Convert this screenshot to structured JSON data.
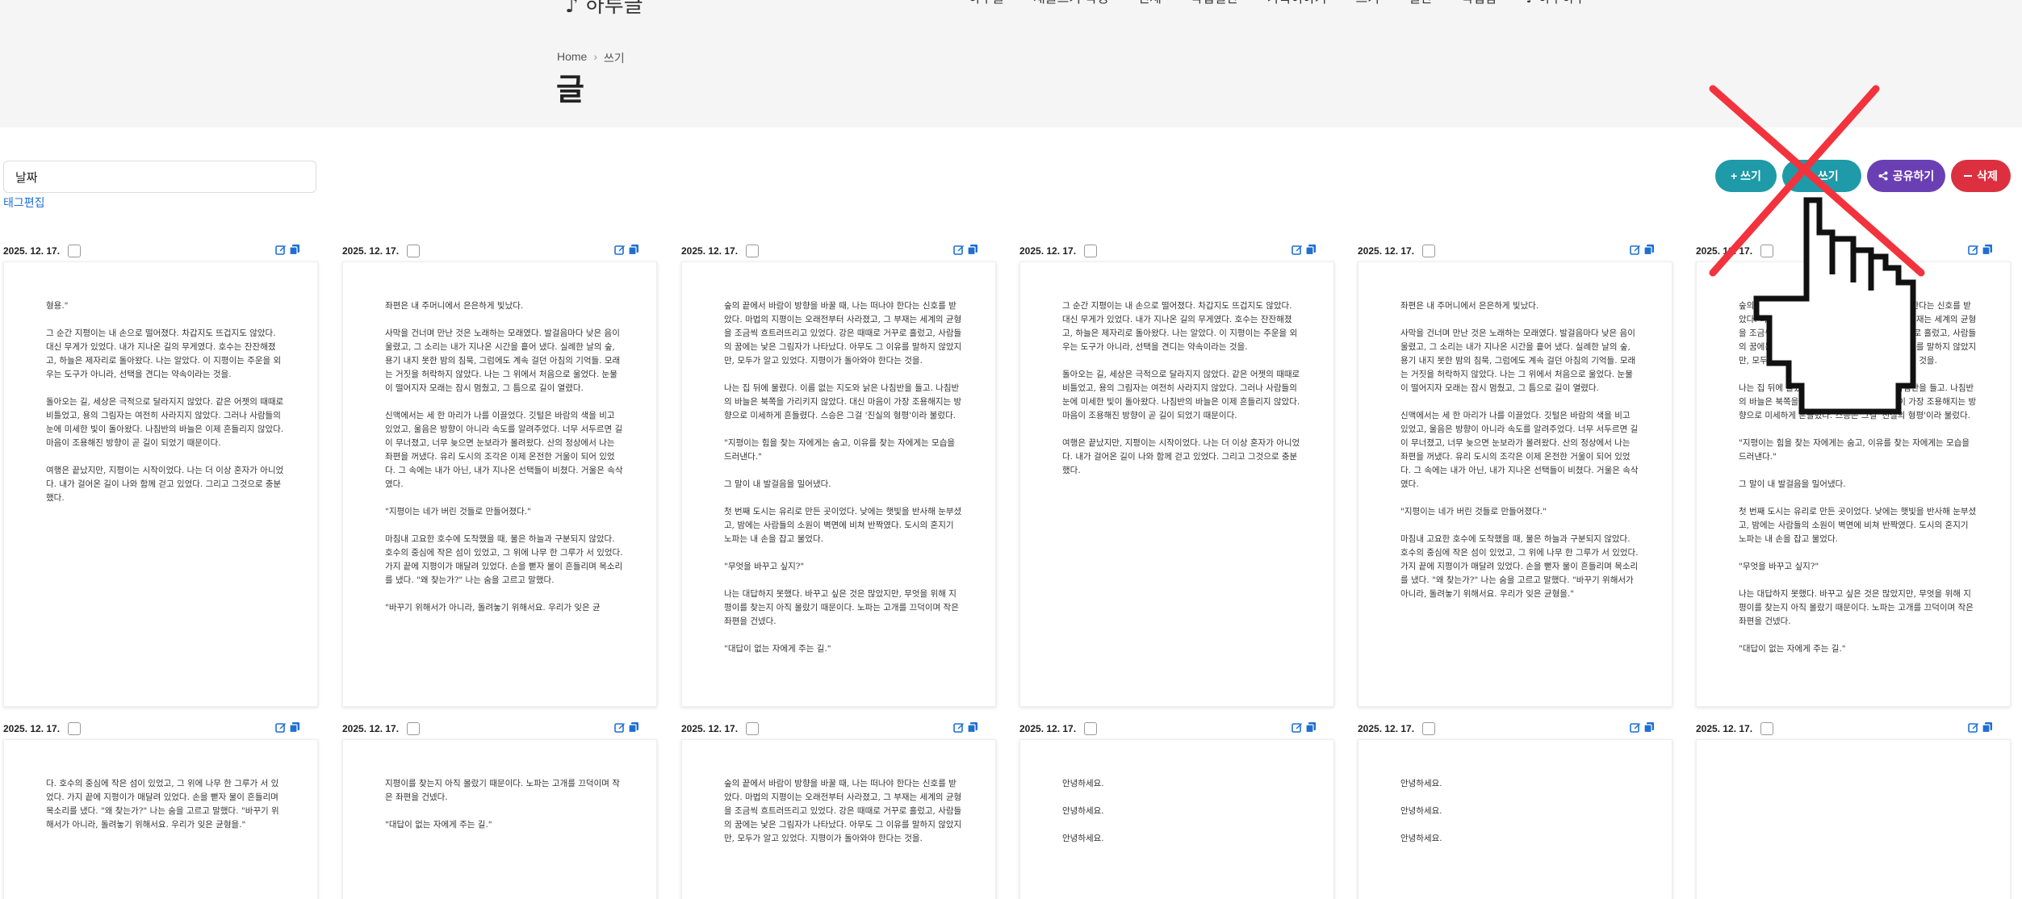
{
  "header": {
    "logo": "♪ 하루글",
    "nav": [
      "하루글",
      "새글쓰기 작성",
      "전체",
      "작업일반",
      "가족이야기",
      "쓰기",
      "일반",
      "작업함",
      "♪ 하루하루"
    ]
  },
  "breadcrumb": {
    "home": "Home",
    "sep": "›",
    "current": "쓰기"
  },
  "page_title": "글",
  "toolbar": {
    "sort_label": "날짜",
    "tag_edit": "태그편집",
    "write": "+ 쓰기",
    "write2": "✎ 쓰기",
    "share": "공유하기",
    "delete": "삭제"
  },
  "colors": {
    "write": "#1e9aa8",
    "share": "#6b3fb4",
    "delete": "#dc3040",
    "accent": "#1f6fd0"
  },
  "cards": [
    {
      "date": "2025. 12. 17.",
      "paragraphs": [
        "형용.\"",
        "그 순간 지평이는 내 손으로 떨어졌다. 차갑지도 뜨겁지도 않았다. 대신 무게가 있었다. 내가 지나온 길의 무게였다. 호수는 잔잔해졌고, 하늘은 제자리로 돌아왔다. 나는 알았다. 이 지평이는 주운을 외우는 도구가 아니라, 선택을 견디는 약속이라는 것을.",
        "돌아오는 길, 세상은 극적으로 달라지지 않았다. 같은 어젯의 때때로 비틀었고, 용의 그림자는 여전히 사라지지 않았다. 그러나 사람들의 눈에 미세한 빛이 돌아왔다. 나침반의 바늘은 이제 흔들리지 않았다. 마음이 조용해진 방향이 곧 길이 되었기 때문이다.",
        "여행은 끝났지만, 지평이는 시작이었다. 나는 더 이상 혼자가 아니었다. 내가 걸어온 길이 나와 함께 걷고 있었다. 그리고 그것으로 충분했다."
      ]
    },
    {
      "date": "2025. 12. 17.",
      "paragraphs": [
        "좌편은 내 주머니에서 은은하게 빛났다.",
        "사막을 건너며 만난 것은 노래하는 모래였다. 발걸음마다 낮은 음이 울렸고, 그 소리는 내가 지나온 시간을 흩어 냈다. 실례한 날의 숲, 용기 내지 못한 밤의 침묵, 그럼에도 계속 걸던 아침의 기억들. 모래는 거짓을 허락하지 않았다. 나는 그 위에서 처음으로 울었다. 눈물이 떨어지자 모래는 잠시 멈췄고, 그 틈으로 길이 열렸다.",
        "신맥에서는 세 한 마리가 나를 이끌었다. 깃털은 바람의 색을 비고 있었고, 울음은 방향이 아니라 속도를 알려주었다. 너무 서두르면 길이 무너졌고, 너무 늦으면 눈보라가 몰려왔다. 산의 정상에서 나는 좌편을 꺼냈다. 유리 도시의 조각은 이제 온전한 거울이 되어 있었다. 그 속에는 내가 아닌, 내가 지나온 선택들이 비쳤다. 거울은 속삭였다.",
        "\"지평이는 네가 버린 것들로 만들어졌다.\"",
        "마침내 고요한 호수에 도착했을 때, 물은 하늘과 구분되지 않았다. 호수의 중심에 작은 섬이 있었고, 그 위에 나무 한 그루가 서 있었다. 가지 끝에 지평이가 매달려 있었다. 손을 뻗자 물이 흔들리며 목소리를 냈다. \"왜 찾는가?\" 나는 숨을 고르고 말했다.",
        "\"바꾸기 위해서가 아니라, 돌려놓기 위해서요. 우리가 잊은 균"
      ]
    },
    {
      "date": "2025. 12. 17.",
      "paragraphs": [
        "숲의 끝에서 바람이 방향을 바꿀 때, 나는 떠나야 한다는 신호를 받았다. 마법의 지평이는 오래전부터 사라졌고, 그 부재는 세계의 균형을 조금씩 흐트러뜨리고 있었다. 강은 때때로 거꾸로 흘렀고, 사람들의 꿈에는 낯은 그림자가 나타났다. 아무도 그 이유를 말하지 않았지만, 모두가 알고 있었다. 지평이가 돌아와야 한다는 것을.",
        "나는 집 뒤에 물렸다. 이름 없는 지도와 낡은 나침반을 들고. 나침반의 바늘은 북쪽을 가리키지 않았다. 대신 마음이 가장 조용해지는 방향으로 미세하게 흔들렸다. 스승은 그걸 '진실의 형평'이라 불렀다.",
        "\"지평이는 힘을 찾는 자에게는 숨고, 이유를 찾는 자에게는 모습을 드러낸다.\"",
        "그 말이 내 발걸음을 밀어냈다.",
        "첫 번째 도시는 유리로 만든 곳이었다. 낮에는 햇빛을 반사해 눈부셨고, 밤에는 사람들의 소원이 벽면에 비쳐 반짝였다. 도시의 혼지기 노파는 내 손을 잡고 물었다.",
        "\"무엇을 바꾸고 싶지?\"",
        "나는 대답하지 못했다. 바꾸고 싶은 것은 많았지만, 무엇을 위해 지평이를 찾는지 아직 몰랐기 때문이다. 노파는 고개를 끄덕이며 작은 좌편을 건넸다.",
        "\"대답이 없는 자에게 주는 길.\""
      ]
    },
    {
      "date": "2025. 12. 17.",
      "paragraphs": [
        "그 순간 지평이는 내 손으로 떨어졌다. 차갑지도 뜨겁지도 않았다. 대신 무게가 있었다. 내가 지나온 길의 무게였다. 호수는 잔잔해졌고, 하늘은 제자리로 돌아왔다. 나는 알았다. 이 지평이는 주운을 외우는 도구가 아니라, 선택을 견디는 약속이라는 것을.",
        "돌아오는 길, 세상은 극적으로 달라지지 않았다. 같은 어젯의 때때로 비틀었고, 용의 그림자는 여전히 사라지지 않았다. 그러나 사람들의 눈에 미세한 빛이 돌아왔다. 나침반의 바늘은 이제 흔들리지 않았다. 마음이 조용해진 방향이 곧 길이 되었기 때문이다.",
        "여행은 끝났지만, 지평이는 시작이었다. 나는 더 이상 혼자가 아니었다. 내가 걸어온 길이 나와 함께 걷고 있었다. 그리고 그것으로 충분했다."
      ]
    },
    {
      "date": "2025. 12. 17.",
      "paragraphs": [
        "좌편은 내 주머니에서 은은하게 빛났다.",
        "사막을 건너며 만난 것은 노래하는 모래였다. 발걸음마다 낮은 음이 울렸고, 그 소리는 내가 지나온 시간을 흩어 냈다. 실례한 날의 숲, 용기 내지 못한 밤의 침묵, 그럼에도 계속 걸던 아침의 기억들. 모래는 거짓을 허락하지 않았다. 나는 그 위에서 처음으로 울었다. 눈물이 떨어지자 모래는 잠시 멈췄고, 그 틈으로 길이 열렸다.",
        "신맥에서는 세 한 마리가 나를 이끌었다. 깃털은 바람의 색을 비고 있었고, 울음은 방향이 아니라 속도를 알려주었다. 너무 서두르면 길이 무너졌고, 너무 늦으면 눈보라가 몰려왔다. 산의 정상에서 나는 좌편을 꺼냈다. 유리 도시의 조각은 이제 온전한 거울이 되어 있었다. 그 속에는 내가 아닌, 내가 지나온 선택들이 비쳤다. 거울은 속삭였다.",
        "\"지평이는 네가 버린 것들로 만들어졌다.\"",
        "마침내 고요한 호수에 도착했을 때, 물은 하늘과 구분되지 않았다. 호수의 중심에 작은 섬이 있었고, 그 위에 나무 한 그루가 서 있었다. 가지 끝에 지평이가 매달려 있었다. 손을 뻗자 물이 흔들리며 목소리를 냈다. \"왜 찾는가?\" 나는 숨을 고르고 말했다. \"바꾸기 위해서가 아니라, 돌려놓기 위해서요. 우리가 잊은 균형을.\""
      ]
    },
    {
      "date": "2025. 12. 17.",
      "paragraphs": [
        "숲의 끝에서 바람이 방향을 바꿀 때, 나는 떠나야 한다는 신호를 받았다. 마법의 지평이는 오래전부터 사라졌고, 그 부재는 세계의 균형을 조금씩 흐트러뜨리고 있었다. 강은 때때로 거꾸로 흘렀고, 사람들의 꿈에는 낯은 그림자가 나타났다. 아무도 그 이유를 말하지 않았지만, 모두가 알고 있었다. 지평이가 돌아와야 한다는 것을.",
        "나는 집 뒤에 물렸다. 이름 없는 지도와 낡은 나침반을 들고. 나침반의 바늘은 북쪽을 가리키지 않았다. 대신 마음이 가장 조용해지는 방향으로 미세하게 흔들렸다. 스승은 그걸 '진실의 형평'이라 불렀다.",
        "\"지평이는 힘을 찾는 자에게는 숨고, 이유를 찾는 자에게는 모습을 드러낸다.\"",
        "그 말이 내 발걸음을 밀어냈다.",
        "첫 번째 도시는 유리로 만든 곳이었다. 낮에는 햇빛을 반사해 눈부셨고, 밤에는 사람들의 소원이 벽면에 비쳐 반짝였다. 도시의 혼지기 노파는 내 손을 잡고 물었다.",
        "\"무엇을 바꾸고 싶지?\"",
        "나는 대답하지 못했다. 바꾸고 싶은 것은 많았지만, 무엇을 위해 지평이를 찾는지 아직 몰랐기 때문이다. 노파는 고개를 끄덕이며 작은 좌편을 건넸다.",
        "\"대답이 없는 자에게 주는 길.\""
      ]
    },
    {
      "date": "2025. 12. 17.",
      "paragraphs": [
        "다. 호수의 중심에 작은 섬이 있었고, 그 위에 나무 한 그루가 서 있었다. 가지 끝에 지평이가 매달려 있었다. 손을 뻗자 물이 흔들리며 목소리를 냈다. \"왜 찾는가?\" 나는 숨을 고르고 말했다. \"바꾸기 위해서가 아니라, 돌려놓기 위해서요. 우리가 잊은 균형을.\""
      ]
    },
    {
      "date": "2025. 12. 17.",
      "paragraphs": [
        "지평이를 찾는지 아직 몰랐기 때문이다. 노파는 고개를 끄덕이며 작은 좌편을 건넸다.",
        "\"대답이 없는 자에게 주는 길.\""
      ]
    },
    {
      "date": "2025. 12. 17.",
      "paragraphs": [
        "숲의 끝에서 바람이 방향을 바꿀 때, 나는 떠나야 한다는 신호를 받았다. 마법의 지평이는 오래전부터 사라졌고, 그 부재는 세계의 균형을 조금씩 흐트러뜨리고 있었다. 강은 때때로 거꾸로 흘렀고, 사람들의 꿈에는 낯은 그림자가 나타났다. 아무도 그 이유를 말하지 않았지만, 모두가 알고 있었다. 지평이가 돌아와야 한다는 것을."
      ]
    },
    {
      "date": "2025. 12. 17.",
      "paragraphs": [
        "안녕하세요.",
        "안녕하세요.",
        "안녕하세요."
      ]
    },
    {
      "date": "2025. 12. 17.",
      "paragraphs": [
        "안녕하세요.",
        "안녕하세요.",
        "안녕하세요."
      ]
    },
    {
      "date": "2025. 12. 17.",
      "paragraphs": []
    }
  ]
}
